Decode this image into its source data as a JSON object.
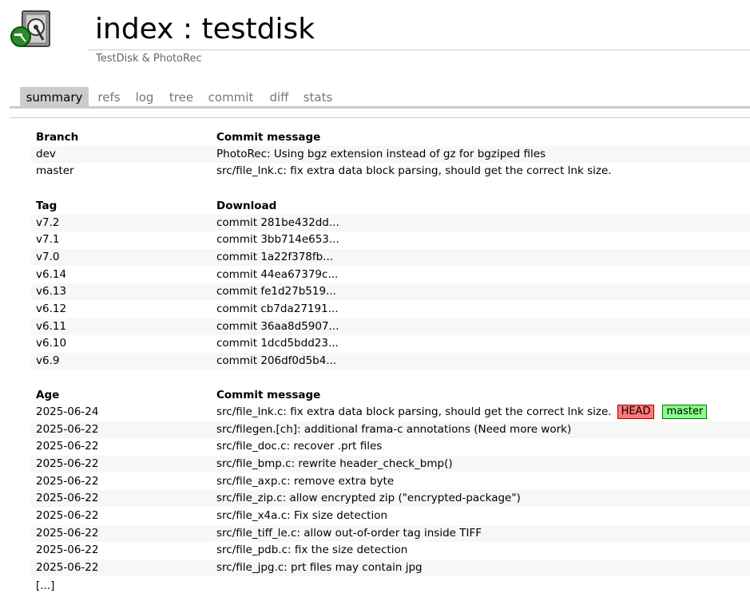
{
  "header": {
    "title": "index : testdisk",
    "subtitle": "TestDisk & PhotoRec"
  },
  "tabs": [
    {
      "label": "summary",
      "active": true
    },
    {
      "label": "refs",
      "active": false
    },
    {
      "label": "log",
      "active": false
    },
    {
      "label": "tree",
      "active": false
    },
    {
      "label": "commit",
      "active": false
    },
    {
      "label": "diff",
      "active": false
    },
    {
      "label": "stats",
      "active": false
    }
  ],
  "branches": {
    "headers": {
      "name": "Branch",
      "message": "Commit message"
    },
    "rows": [
      {
        "name": "dev",
        "message": "PhotoRec: Using bgz extension instead of gz for bgziped files"
      },
      {
        "name": "master",
        "message": "src/file_lnk.c: fix extra data block parsing, should get the correct lnk size."
      }
    ]
  },
  "tags": {
    "headers": {
      "name": "Tag",
      "download": "Download"
    },
    "rows": [
      {
        "name": "v7.2",
        "download": "commit 281be432dd..."
      },
      {
        "name": "v7.1",
        "download": "commit 3bb714e653..."
      },
      {
        "name": "v7.0",
        "download": "commit 1a22f378fb..."
      },
      {
        "name": "v6.14",
        "download": "commit 44ea67379c..."
      },
      {
        "name": "v6.13",
        "download": "commit fe1d27b519..."
      },
      {
        "name": "v6.12",
        "download": "commit cb7da27191..."
      },
      {
        "name": "v6.11",
        "download": "commit 36aa8d5907..."
      },
      {
        "name": "v6.10",
        "download": "commit 1dcd5bdd23..."
      },
      {
        "name": "v6.9",
        "download": "commit 206df0d5b4..."
      }
    ]
  },
  "log": {
    "headers": {
      "age": "Age",
      "message": "Commit message"
    },
    "rows": [
      {
        "age": "2025-06-24",
        "message": "src/file_lnk.c: fix extra data block parsing, should get the correct lnk size.",
        "badges": [
          "HEAD",
          "master"
        ]
      },
      {
        "age": "2025-06-22",
        "message": "src/filegen.[ch]: additional frama-c annotations (Need more work)"
      },
      {
        "age": "2025-06-22",
        "message": "src/file_doc.c: recover .prt files"
      },
      {
        "age": "2025-06-22",
        "message": "src/file_bmp.c: rewrite header_check_bmp()"
      },
      {
        "age": "2025-06-22",
        "message": "src/file_axp.c: remove extra byte"
      },
      {
        "age": "2025-06-22",
        "message": "src/file_zip.c: allow encrypted zip (\"encrypted-package\")"
      },
      {
        "age": "2025-06-22",
        "message": "src/file_x4a.c: Fix size detection"
      },
      {
        "age": "2025-06-22",
        "message": "src/file_tiff_le.c: allow out-of-order tag inside TIFF"
      },
      {
        "age": "2025-06-22",
        "message": "src/file_pdb.c: fix the size detection"
      },
      {
        "age": "2025-06-22",
        "message": "src/file_jpg.c: prt files may contain jpg"
      }
    ],
    "more_label": "[...]"
  },
  "colors": {
    "head_badge": "#ff7777",
    "master_badge": "#88ff88",
    "tab_active": "#cccccc",
    "row_alt": "#f7f7f7"
  },
  "icons": {
    "logo": "hard-disk-logo-icon"
  }
}
